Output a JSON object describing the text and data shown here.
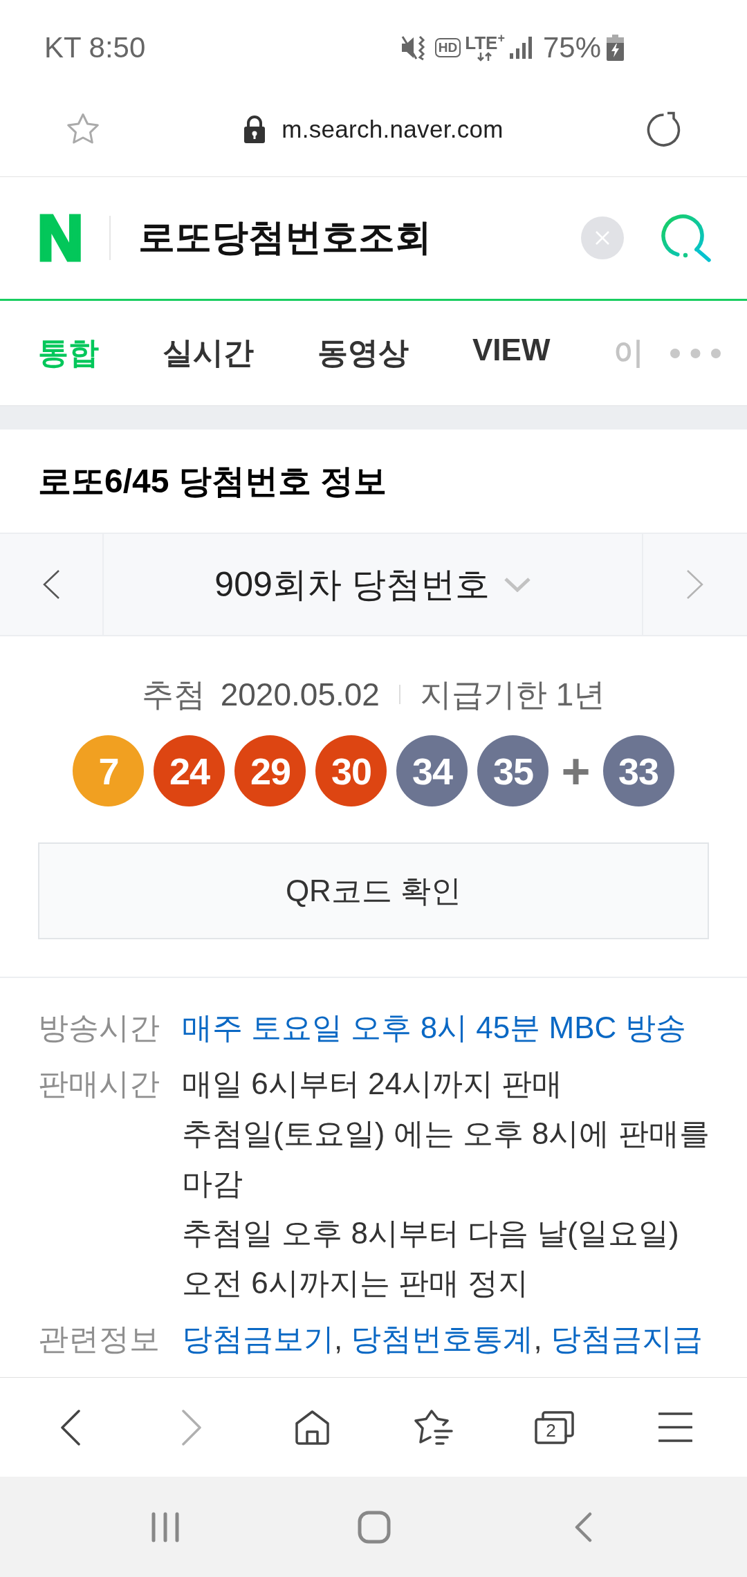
{
  "status_bar": {
    "carrier_time": "KT 8:50",
    "hd_label": "HD",
    "network": "LTE$^{+}$",
    "battery": "75%"
  },
  "address_bar": {
    "bookmarked": false,
    "secure": true,
    "url": "m.search.naver.com"
  },
  "search": {
    "logo": "N",
    "query": "로또당첨번호조회"
  },
  "tabs": [
    {
      "label": "통합",
      "selected": true,
      "faded": false
    },
    {
      "label": "실시간",
      "selected": false,
      "faded": false
    },
    {
      "label": "동영상",
      "selected": false,
      "faded": false
    },
    {
      "label": "VIEW",
      "selected": false,
      "faded": false
    },
    {
      "label": "이",
      "selected": false,
      "faded": true
    }
  ],
  "lotto": {
    "title": "로또6/45 당첨번호 정보",
    "round_selector": {
      "label": "909회차 당첨번호",
      "prev_disabled": false,
      "next_disabled": true
    },
    "draw_label": "추첨",
    "draw_date": "2020.05.02",
    "deadline": "지급기한 1년",
    "numbers": [
      {
        "value": "7",
        "color": "#f1a021"
      },
      {
        "value": "24",
        "color": "#dd4512"
      },
      {
        "value": "29",
        "color": "#dd4512"
      },
      {
        "value": "30",
        "color": "#dd4512"
      },
      {
        "value": "34",
        "color": "#6c7592"
      },
      {
        "value": "35",
        "color": "#6c7592"
      }
    ],
    "bonus_sign": "+",
    "bonus": {
      "value": "33",
      "color": "#6c7592"
    },
    "qr_button": "QR코드 확인"
  },
  "info": [
    {
      "label": "방송시간",
      "kind": "link",
      "value": "매주 토요일 오후 8시 45분 MBC 방송"
    },
    {
      "label": "판매시간",
      "kind": "text",
      "lines": [
        "매일 6시부터 24시까지 판매",
        "추첨일(토요일) 에는 오후 8시에 판매를 마감",
        "추첨일 오후 8시부터 다음 날(일요일) 오전 6시까지는 판매 정지"
      ]
    },
    {
      "label": "관련정보",
      "kind": "links",
      "separator": ", ",
      "links": [
        "당첨금보기",
        "당첨번호통계",
        "당첨금지급"
      ]
    }
  ],
  "browser_toolbar": [
    {
      "kind": "back",
      "disabled": false
    },
    {
      "kind": "forward",
      "disabled": true
    },
    {
      "kind": "home",
      "disabled": false
    },
    {
      "kind": "bookmarks",
      "disabled": false
    },
    {
      "kind": "tabs",
      "disabled": false,
      "count": "2"
    },
    {
      "kind": "menu",
      "disabled": false
    }
  ],
  "system_nav": [
    {
      "kind": "recents"
    },
    {
      "kind": "home"
    },
    {
      "kind": "back"
    }
  ]
}
